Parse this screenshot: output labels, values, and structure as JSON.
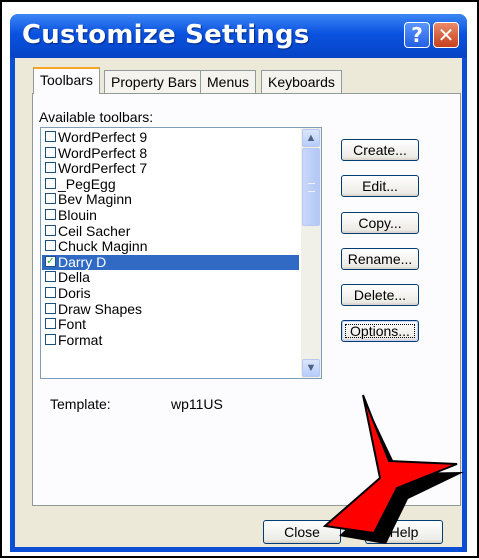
{
  "window": {
    "title": "Customize Settings",
    "help_glyph": "?",
    "close_glyph": "✕"
  },
  "tabs": [
    {
      "label": "Toolbars",
      "active": true
    },
    {
      "label": "Property Bars",
      "active": false
    },
    {
      "label": "Menus",
      "active": false
    },
    {
      "label": "Keyboards",
      "active": false
    }
  ],
  "toolbars_panel": {
    "available_label": "Available toolbars:",
    "items": [
      {
        "label": "WordPerfect 9",
        "checked": false,
        "selected": false
      },
      {
        "label": "WordPerfect 8",
        "checked": false,
        "selected": false
      },
      {
        "label": "WordPerfect 7",
        "checked": false,
        "selected": false
      },
      {
        "label": "_PegEgg",
        "checked": false,
        "selected": false
      },
      {
        "label": "Bev Maginn",
        "checked": false,
        "selected": false
      },
      {
        "label": "Blouin",
        "checked": false,
        "selected": false
      },
      {
        "label": "Ceil Sacher",
        "checked": false,
        "selected": false
      },
      {
        "label": "Chuck Maginn",
        "checked": false,
        "selected": false
      },
      {
        "label": "Darry D",
        "checked": true,
        "selected": true
      },
      {
        "label": "Della",
        "checked": false,
        "selected": false
      },
      {
        "label": "Doris",
        "checked": false,
        "selected": false
      },
      {
        "label": "Draw Shapes",
        "checked": false,
        "selected": false
      },
      {
        "label": "Font",
        "checked": false,
        "selected": false
      },
      {
        "label": "Format",
        "checked": false,
        "selected": false
      }
    ],
    "buttons": {
      "create": "Create...",
      "edit": "Edit...",
      "copy": "Copy...",
      "rename": "Rename...",
      "delete": "Delete...",
      "options": "Options..."
    },
    "template_label": "Template:",
    "template_value": "wp11US"
  },
  "footer": {
    "close": "Close",
    "help": "Help"
  },
  "colors": {
    "accent": "#0a4fd6",
    "selection": "#316ac5",
    "annotation_arrow": "#ff0000"
  }
}
